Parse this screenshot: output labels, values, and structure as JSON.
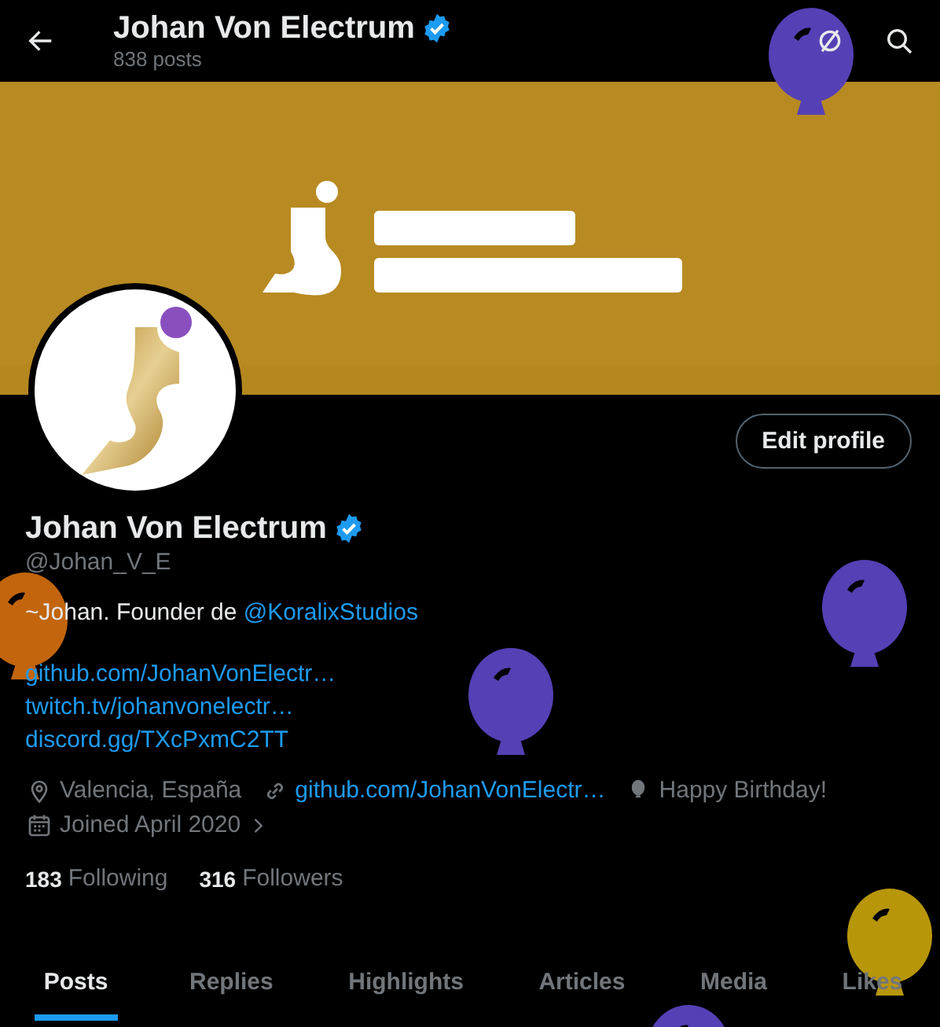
{
  "header": {
    "title": "Johan Von Electrum",
    "verified": true,
    "subtitle": "838 posts"
  },
  "edit_button": "Edit profile",
  "profile": {
    "name": "Johan Von Electrum",
    "verified": true,
    "handle": "@Johan_V_E",
    "bio": [
      {
        "kind": "text",
        "text": "~Johan. Founder de "
      },
      {
        "kind": "link",
        "text": "@KoralixStudios"
      }
    ],
    "links": [
      "github.com/JohanVonElectr…",
      "twitch.tv/johanvonelectr…",
      "discord.gg/TXcPxmC2TT"
    ],
    "meta": [
      {
        "kind": "location",
        "text": "Valencia, España"
      },
      {
        "kind": "url",
        "text": "github.com/JohanVonElectr…"
      },
      {
        "kind": "birthday",
        "text": "Happy Birthday!"
      },
      {
        "kind": "joined",
        "text": "Joined April 2020"
      }
    ],
    "stats": [
      {
        "count": "183",
        "label": "Following"
      },
      {
        "count": "316",
        "label": "Followers"
      }
    ]
  },
  "tabs": [
    {
      "label": "Posts",
      "selected": true
    },
    {
      "label": "Replies",
      "selected": false
    },
    {
      "label": "Highlights",
      "selected": false
    },
    {
      "label": "Articles",
      "selected": false
    },
    {
      "label": "Media",
      "selected": false
    },
    {
      "label": "Likes",
      "selected": false
    }
  ],
  "balloons": [
    {
      "color": "#5540b5"
    },
    {
      "color": "#c2650c"
    },
    {
      "color": "#5540b5"
    },
    {
      "color": "#5540b5"
    },
    {
      "color": "#b8960a"
    },
    {
      "color": "#5540b5"
    }
  ]
}
